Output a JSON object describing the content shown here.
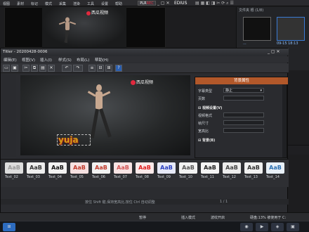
{
  "background_app": {
    "menu": [
      "视图",
      "素材",
      "标记",
      "模式",
      "采集",
      "渲染",
      "工具",
      "设置",
      "帮助"
    ],
    "plr_label": "PLR",
    "rec_label": "REC",
    "edius_label": "EDIUS",
    "watermark": "西瓜视频",
    "folder_label": "文件夹",
    "bin_info": "根 (1/8)",
    "bin_items": [
      {
        "caption": "..."
      },
      {
        "caption": "09-15 18:13"
      }
    ]
  },
  "titler": {
    "title": "Titler - 20200428-0006",
    "menu": [
      "编辑(E)",
      "视图(V)",
      "插入(I)",
      "样式(S)",
      "布局(L)",
      "帮助(H)"
    ],
    "canvas_watermark": "西瓜视频",
    "canvas_text": "yuja",
    "properties": {
      "header": "背景属性",
      "rows": [
        {
          "label": "字幕类型",
          "value": "静止"
        },
        {
          "label": "页数",
          "value": ""
        }
      ],
      "section_video": "视频设置(V)",
      "video_rows": [
        {
          "label": "视频格式",
          "value": ""
        },
        {
          "label": "帧尺寸",
          "value": ""
        },
        {
          "label": "宽高比",
          "value": ""
        }
      ],
      "section_bg": "背景(B)"
    },
    "styles": [
      "Text_02",
      "Text_03",
      "Text_04",
      "Text_05",
      "Text_06",
      "Text_07",
      "Text_08",
      "Text_09",
      "Text_10",
      "Text_11",
      "Text_12",
      "Text_13",
      "Text_14"
    ],
    "status": {
      "hint": "按住 Shift 键,保持宽高比,按住 Ctrl 自动调整",
      "page": "1 / 1"
    }
  },
  "bottom_status": {
    "items": [
      "暂停",
      "插入模式",
      "波纹开启",
      "硬盘:13% 被使用于 C:"
    ]
  },
  "colors": {
    "accent_orange": "#b2582a",
    "selection_blue": "#3a7bd5",
    "watermark_red": "#e0293e"
  }
}
